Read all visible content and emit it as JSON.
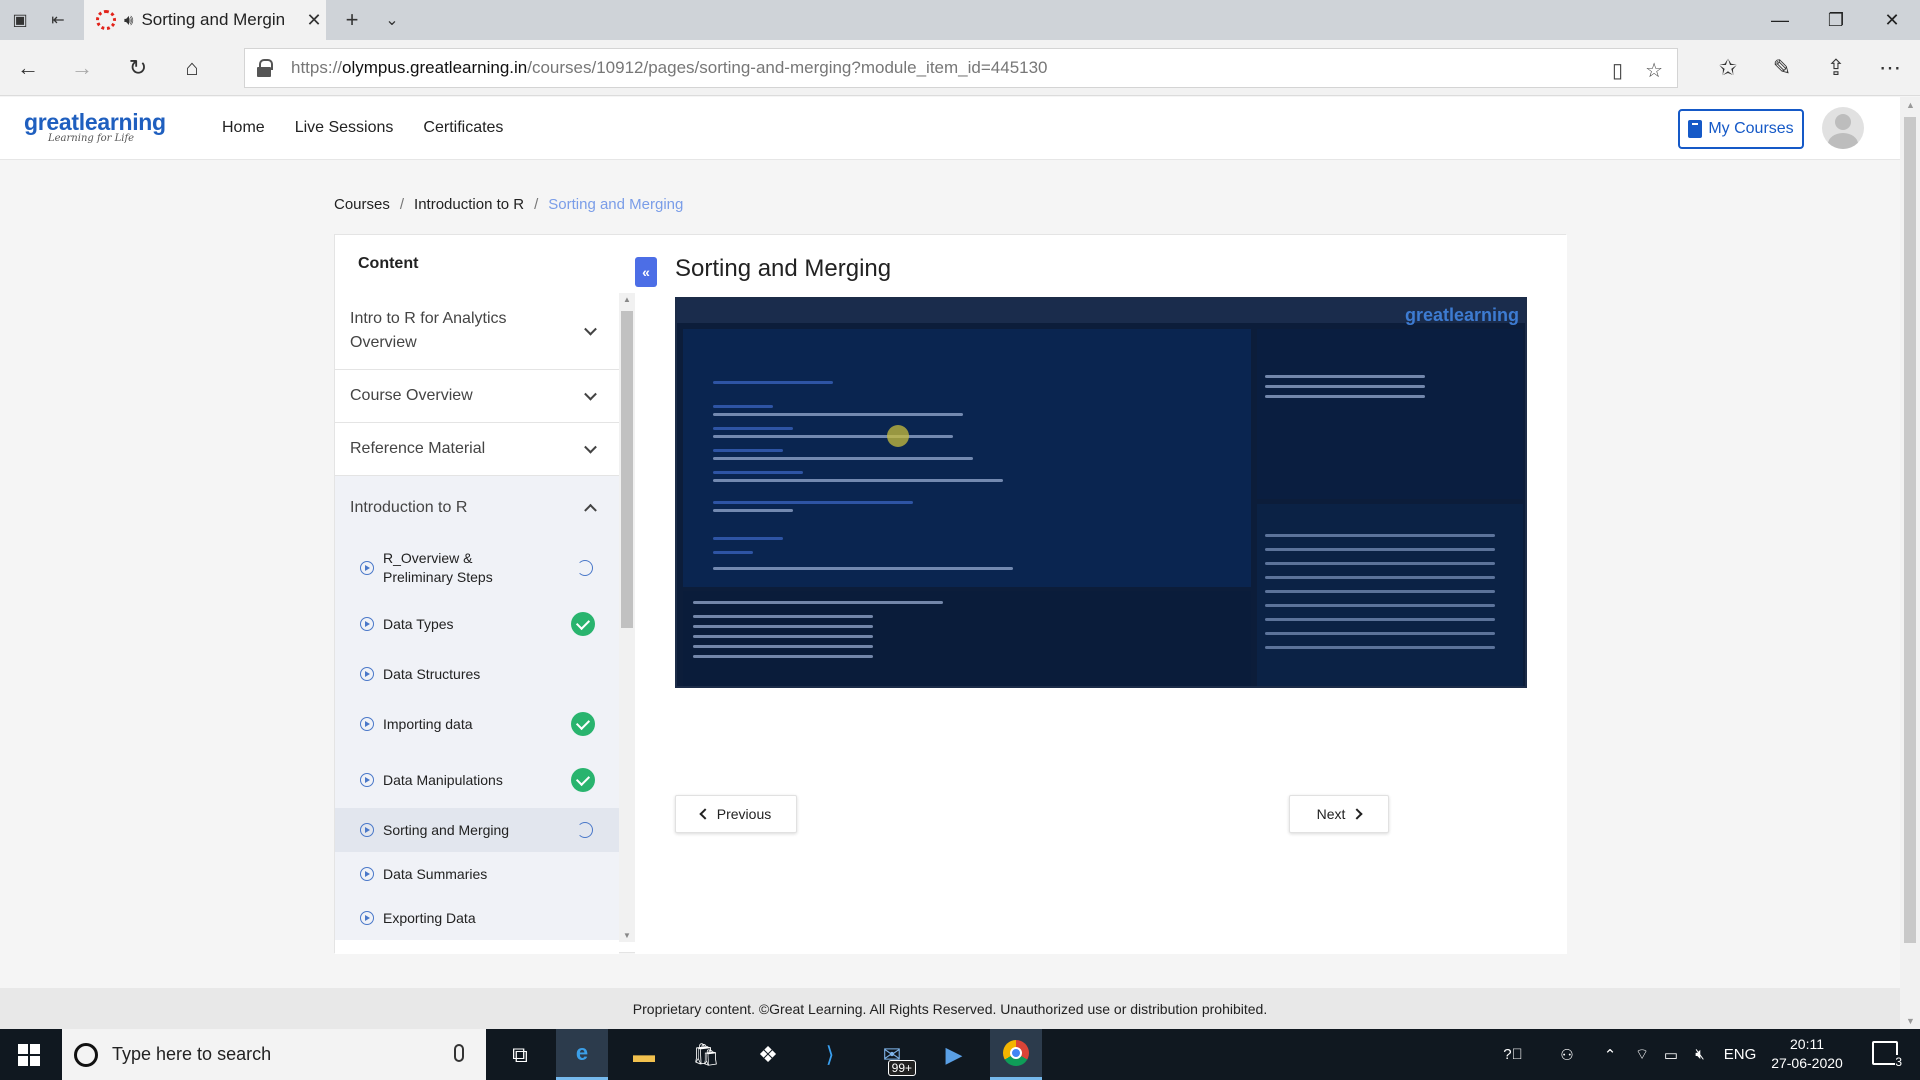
{
  "browser": {
    "tab_title": "Sorting and Mergin",
    "url_prefix": "https://",
    "url_host": "olympus.greatlearning.in",
    "url_path": "/courses/10912/pages/sorting-and-merging?module_item_id=445130"
  },
  "header": {
    "logo_text": "greatlearning",
    "logo_tagline": "Learning for Life",
    "nav": [
      "Home",
      "Live Sessions",
      "Certificates"
    ],
    "my_courses": "My Courses"
  },
  "breadcrumb": [
    "Courses",
    "Introduction to R",
    "Sorting and Merging"
  ],
  "sidebar": {
    "heading": "Content",
    "sections": [
      {
        "label": "Intro to R for Analytics Overview",
        "expanded": false
      },
      {
        "label": "Course Overview",
        "expanded": false
      },
      {
        "label": "Reference Material",
        "expanded": false
      },
      {
        "label": "Introduction to R",
        "expanded": true
      }
    ],
    "items": [
      {
        "label": "R_Overview & Preliminary Steps",
        "status": "in-progress"
      },
      {
        "label": "Data Types",
        "status": "completed"
      },
      {
        "label": "Data Structures",
        "status": "none"
      },
      {
        "label": "Importing data",
        "status": "completed"
      },
      {
        "label": "Data Manipulations",
        "status": "completed"
      },
      {
        "label": "Sorting and Merging",
        "status": "in-progress",
        "active": true
      },
      {
        "label": "Data Summaries",
        "status": "none"
      },
      {
        "label": "Exporting Data",
        "status": "none"
      }
    ]
  },
  "main": {
    "title": "Sorting and Merging",
    "video_brand": "greatlearning",
    "prev_label": "Previous",
    "next_label": "Next"
  },
  "footer": {
    "text": "Proprietary content. ©Great Learning. All Rights Reserved. Unauthorized use or distribution prohibited."
  },
  "taskbar": {
    "search_placeholder": "Type here to search",
    "mail_badge": "99+",
    "language": "ENG",
    "time": "20:11",
    "date": "27-06-2020",
    "notification_count": "3"
  },
  "colors": {
    "brand_blue": "#1559c7",
    "accent_link": "#7a9de8",
    "completed_green": "#29b46e",
    "collapse_button": "#4c6ee6"
  }
}
